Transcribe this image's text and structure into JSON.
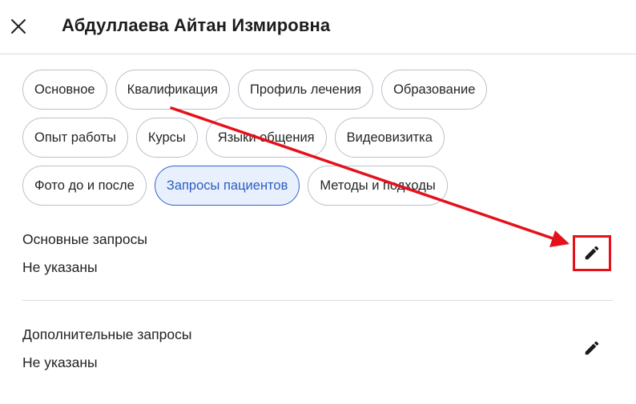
{
  "header": {
    "title": "Абдуллаева Айтан Измировна",
    "close_icon": "close-icon"
  },
  "tabs": [
    [
      {
        "label": "Основное",
        "active": false
      },
      {
        "label": "Квалификация",
        "active": false
      },
      {
        "label": "Профиль лечения",
        "active": false
      },
      {
        "label": "Образование",
        "active": false
      }
    ],
    [
      {
        "label": "Опыт работы",
        "active": false
      },
      {
        "label": "Курсы",
        "active": false
      },
      {
        "label": "Языки общения",
        "active": false
      },
      {
        "label": "Видеовизитка",
        "active": false
      }
    ],
    [
      {
        "label": "Фото до и после",
        "active": false
      },
      {
        "label": "Запросы пациентов",
        "active": true
      },
      {
        "label": "Методы и подходы",
        "active": false
      }
    ]
  ],
  "sections": {
    "main": {
      "label": "Основные запросы",
      "value": "Не указаны",
      "edit_icon": "pencil-icon"
    },
    "additional": {
      "label": "Дополнительные запросы",
      "value": "Не указаны",
      "edit_icon": "pencil-icon"
    }
  },
  "colors": {
    "accent": "#2f63c8",
    "active_chip_bg": "#e9f0fd",
    "annotation": "#e4111b"
  }
}
